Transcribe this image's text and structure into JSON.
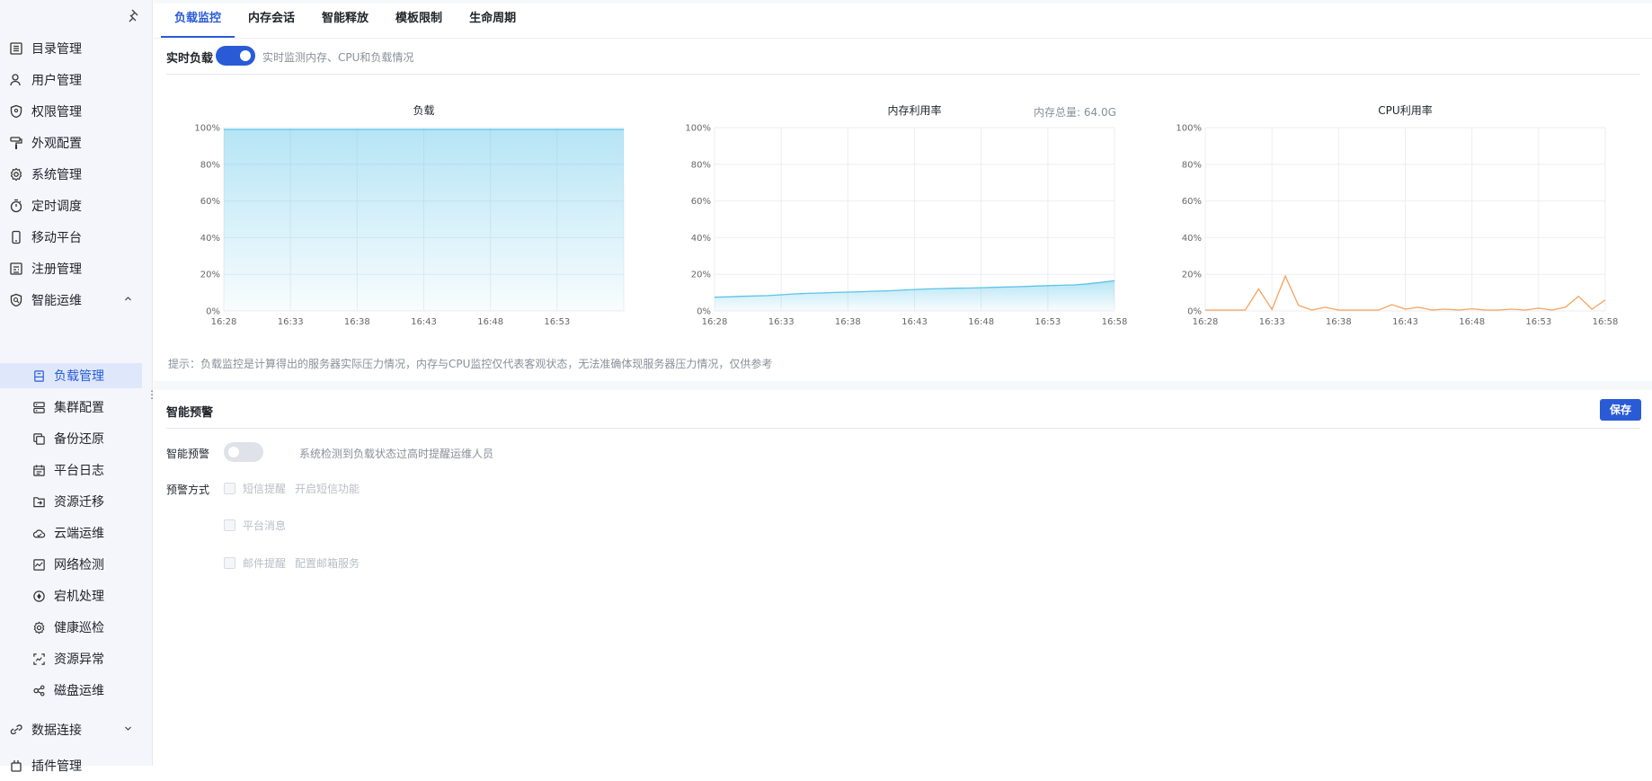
{
  "sidebar": {
    "items": [
      {
        "label": "目录管理",
        "icon": "list-icon"
      },
      {
        "label": "用户管理",
        "icon": "user-icon"
      },
      {
        "label": "权限管理",
        "icon": "shield-icon"
      },
      {
        "label": "外观配置",
        "icon": "paint-roller-icon"
      },
      {
        "label": "系统管理",
        "icon": "gear-icon"
      },
      {
        "label": "定时调度",
        "icon": "stopwatch-icon"
      },
      {
        "label": "移动平台",
        "icon": "mobile-icon"
      },
      {
        "label": "注册管理",
        "icon": "register-icon"
      },
      {
        "label": "智能运维",
        "icon": "monitor-search-icon"
      }
    ],
    "sub_items": [
      {
        "label": "负载管理",
        "icon": "server-doc-icon",
        "active": true
      },
      {
        "label": "集群配置",
        "icon": "cluster-icon"
      },
      {
        "label": "备份还原",
        "icon": "backup-icon"
      },
      {
        "label": "平台日志",
        "icon": "calendar-log-icon"
      },
      {
        "label": "资源迁移",
        "icon": "folder-move-icon"
      },
      {
        "label": "云端运维",
        "icon": "cloud-icon"
      },
      {
        "label": "网络检测",
        "icon": "network-icon"
      },
      {
        "label": "宕机处理",
        "icon": "target-icon"
      },
      {
        "label": "健康巡检",
        "icon": "gear-icon"
      },
      {
        "label": "资源异常",
        "icon": "scan-icon"
      },
      {
        "label": "磁盘运维",
        "icon": "disk-nodes-icon"
      }
    ],
    "after_items": [
      {
        "label": "数据连接",
        "icon": "link-icon"
      },
      {
        "label": "插件管理",
        "icon": "plugin-icon"
      }
    ]
  },
  "tabs": [
    {
      "label": "负载监控",
      "active": true
    },
    {
      "label": "内存会话"
    },
    {
      "label": "智能释放"
    },
    {
      "label": "模板限制"
    },
    {
      "label": "生命周期"
    }
  ],
  "realtime": {
    "label": "实时负载",
    "hint": "实时监测内存、CPU和负载情况",
    "enabled": true
  },
  "memory_total": "内存总量: 64.0G",
  "tip": "提示：负载监控是计算得出的服务器实际压力情况，内存与CPU监控仅代表客观状态，无法准确体现服务器压力情况，仅供参考",
  "alert": {
    "section_title": "智能预警",
    "save_label": "保存",
    "toggle_label": "智能预警",
    "toggle_hint": "系统检测到负载状态过高时提醒运维人员",
    "enabled": false,
    "method_label": "预警方式",
    "methods": [
      {
        "label": "短信提醒",
        "extra": "开启短信功能"
      },
      {
        "label": "平台消息",
        "extra": ""
      },
      {
        "label": "邮件提醒",
        "extra": "配置邮箱服务"
      }
    ]
  },
  "colors": {
    "accent": "#2a5bd7",
    "load_line": "#5bc4e8",
    "memory_line": "#5bc4e8",
    "cpu_line": "#f5a25d"
  },
  "chart_data": [
    {
      "type": "area",
      "title": "负载",
      "ylim": [
        0,
        100
      ],
      "y_ticks": [
        "0%",
        "20%",
        "40%",
        "60%",
        "80%",
        "100%"
      ],
      "x_ticks": [
        "16:28",
        "16:33",
        "16:38",
        "16:43",
        "16:48",
        "16:53"
      ],
      "x_range_minutes": [
        0,
        30
      ],
      "series": [
        {
          "values": [
            99,
            99,
            99,
            99,
            99,
            99,
            99,
            99,
            99,
            99,
            99,
            99,
            99,
            99,
            99,
            99,
            99,
            99,
            99,
            99,
            99,
            99,
            99,
            99,
            99,
            99,
            99,
            99,
            99,
            99,
            99
          ]
        }
      ]
    },
    {
      "type": "area",
      "title": "内存利用率",
      "ylim": [
        0,
        100
      ],
      "y_ticks": [
        "0%",
        "20%",
        "40%",
        "60%",
        "80%",
        "100%"
      ],
      "x_ticks": [
        "16:28",
        "16:33",
        "16:38",
        "16:43",
        "16:48",
        "16:53",
        "16:58"
      ],
      "x_range_minutes": [
        0,
        30
      ],
      "series": [
        {
          "values": [
            7.5,
            7.7,
            8.0,
            8.2,
            8.4,
            8.8,
            9.3,
            9.6,
            9.8,
            10.1,
            10.3,
            10.5,
            10.8,
            11.0,
            11.3,
            11.7,
            12.0,
            12.2,
            12.4,
            12.5,
            12.7,
            12.9,
            13.1,
            13.3,
            13.6,
            13.8,
            14.0,
            14.2,
            14.8,
            15.6,
            16.5
          ]
        }
      ]
    },
    {
      "type": "line",
      "title": "CPU利用率",
      "ylim": [
        0,
        100
      ],
      "y_ticks": [
        "0%",
        "20%",
        "40%",
        "60%",
        "80%",
        "100%"
      ],
      "x_ticks": [
        "16:28",
        "16:33",
        "16:38",
        "16:43",
        "16:48",
        "16:53",
        "16:58"
      ],
      "x_range_minutes": [
        0,
        30
      ],
      "series": [
        {
          "values": [
            0.5,
            0.5,
            0.5,
            0.5,
            12,
            0.8,
            19,
            3,
            0.5,
            2,
            0.5,
            0.5,
            0.5,
            0.5,
            3.5,
            1,
            2,
            0.5,
            1,
            0.5,
            1.2,
            0.5,
            0.5,
            1,
            0.5,
            1.5,
            0.5,
            2,
            8,
            1,
            6
          ]
        }
      ]
    }
  ]
}
